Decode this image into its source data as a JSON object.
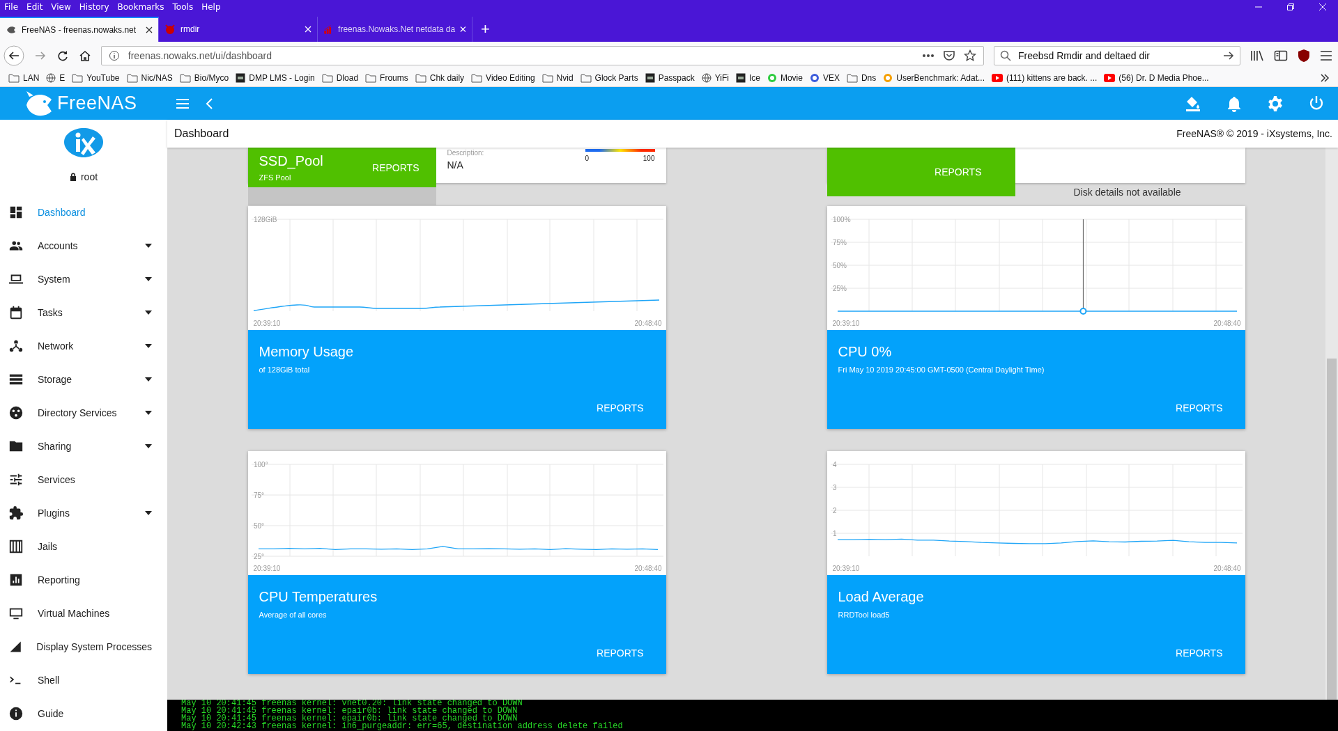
{
  "browser": {
    "menu": [
      "File",
      "Edit",
      "View",
      "History",
      "Bookmarks",
      "Tools",
      "Help"
    ],
    "tabs": [
      {
        "title": "FreeNAS - freenas.nowaks.net",
        "selected": true,
        "kind": "freenas"
      },
      {
        "title": "rmdir",
        "selected": false,
        "kind": "freebsd"
      },
      {
        "title": "freenas.Nowaks.Net netdata da",
        "selected": false,
        "kind": "netdata"
      }
    ],
    "new_tab": "+",
    "address": "freenas.nowaks.net/ui/dashboard",
    "search": {
      "value": "Freebsd Rmdir and deltaed dir"
    },
    "bookmarks": [
      {
        "label": "LAN",
        "kind": "folder"
      },
      {
        "label": "E",
        "kind": "globe"
      },
      {
        "label": "YouTube",
        "kind": "folder"
      },
      {
        "label": "Nic/NAS",
        "kind": "folder"
      },
      {
        "label": "Bio/Myco",
        "kind": "folder"
      },
      {
        "label": "DMP LMS - Login",
        "kind": "app"
      },
      {
        "label": "Dload",
        "kind": "folder"
      },
      {
        "label": "Froums",
        "kind": "folder"
      },
      {
        "label": "Chk daily",
        "kind": "folder"
      },
      {
        "label": "Video Editing",
        "kind": "folder"
      },
      {
        "label": "Nvid",
        "kind": "folder"
      },
      {
        "label": "Glock Parts",
        "kind": "folder"
      },
      {
        "label": "Passpack",
        "kind": "app"
      },
      {
        "label": "YiFi",
        "kind": "globe"
      },
      {
        "label": "Ice",
        "kind": "app"
      },
      {
        "label": "Movie",
        "kind": "dot",
        "color": "#2ecc40"
      },
      {
        "label": "VEX",
        "kind": "dot",
        "color": "#3b5bdb"
      },
      {
        "label": "Dns",
        "kind": "folder"
      },
      {
        "label": "UserBenchmark: Adat...",
        "kind": "dot",
        "color": "#f59f00"
      },
      {
        "label": "(111) kittens are back. ...",
        "kind": "video"
      },
      {
        "label": "(56) Dr. D Media Phoe...",
        "kind": "video"
      }
    ]
  },
  "app_bar": {
    "logo": "FreeNAS"
  },
  "sidebar": {
    "user": "root",
    "items": [
      {
        "label": "Dashboard",
        "selected": true,
        "expandable": false
      },
      {
        "label": "Accounts",
        "selected": false,
        "expandable": true
      },
      {
        "label": "System",
        "selected": false,
        "expandable": true
      },
      {
        "label": "Tasks",
        "selected": false,
        "expandable": true
      },
      {
        "label": "Network",
        "selected": false,
        "expandable": true
      },
      {
        "label": "Storage",
        "selected": false,
        "expandable": true
      },
      {
        "label": "Directory Services",
        "selected": false,
        "expandable": true
      },
      {
        "label": "Sharing",
        "selected": false,
        "expandable": true
      },
      {
        "label": "Services",
        "selected": false,
        "expandable": false
      },
      {
        "label": "Plugins",
        "selected": false,
        "expandable": true
      },
      {
        "label": "Jails",
        "selected": false,
        "expandable": false
      },
      {
        "label": "Reporting",
        "selected": false,
        "expandable": false
      },
      {
        "label": "Virtual Machines",
        "selected": false,
        "expandable": false
      },
      {
        "label": "Display System Processes",
        "selected": false,
        "expandable": false
      },
      {
        "label": "Shell",
        "selected": false,
        "expandable": false
      },
      {
        "label": "Guide",
        "selected": false,
        "expandable": false
      }
    ]
  },
  "page_header": {
    "title": "Dashboard",
    "copyright": "FreeNAS® © 2019 - iXsystems, Inc."
  },
  "pool_card": {
    "name": "SSD_Pool",
    "type": "ZFS Pool",
    "button": "REPORTS",
    "description_label": "Description:",
    "description": "N/A",
    "scale_min": "0",
    "scale_max": "100"
  },
  "disk_card": {
    "button": "REPORTS",
    "note": "Disk details not available"
  },
  "widgets": [
    {
      "title": "Memory Usage",
      "subtitle": "of 128GiB total",
      "button": "REPORTS",
      "max_label": "128GiB",
      "start_time": "20:39:10",
      "end_time": "20:48:40",
      "hover_marker": false
    },
    {
      "title": "CPU 0%",
      "subtitle": "Fri May 10 2019 20:45:00 GMT-0500 (Central Daylight Time)",
      "button": "REPORTS",
      "start_time": "20:39:10",
      "end_time": "20:48:40",
      "hover_marker": true,
      "chart_data": {
        "type": "line",
        "grid": true,
        "ylim": [
          0,
          100
        ],
        "yticks": [
          {
            "value": 25,
            "label": "25%"
          },
          {
            "value": 50,
            "label": "50%"
          },
          {
            "value": 75,
            "label": "75%"
          },
          {
            "value": 100,
            "label": "100%"
          }
        ],
        "series": [
          {
            "color": "#1ea5f7",
            "values": [
              0,
              0,
              0,
              0,
              0,
              0,
              0,
              0,
              0,
              0,
              0,
              0,
              0,
              0,
              0,
              0,
              0,
              0,
              0,
              0
            ]
          }
        ]
      }
    },
    {
      "title": "CPU Temperatures",
      "subtitle": "Average of all cores",
      "button": "REPORTS",
      "start_time": "20:39:10",
      "end_time": "20:48:40",
      "hover_marker": false,
      "chart_data": {
        "type": "line",
        "grid": true,
        "ylim": [
          25,
          100
        ],
        "yticks": [
          {
            "value": 25,
            "label": "25°"
          },
          {
            "value": 50,
            "label": "50°"
          },
          {
            "value": 75,
            "label": "75°"
          },
          {
            "value": 100,
            "label": "100°"
          }
        ],
        "series": [
          {
            "color": "#1ea5f7",
            "values": [
              31,
              31,
              31.5,
              31,
              31.5,
              30.5,
              31,
              31,
              30.8,
              31,
              30.5,
              31,
              33,
              31,
              31,
              31.2,
              31,
              30.8,
              31,
              30.5,
              31.2,
              30.8,
              30.5,
              31,
              30.8,
              31,
              30.5
            ]
          }
        ]
      }
    },
    {
      "title": "Load Average",
      "subtitle": "RRDTool load5",
      "button": "REPORTS",
      "start_time": "20:39:10",
      "end_time": "20:48:40",
      "hover_marker": false,
      "chart_data": {
        "type": "line",
        "grid": true,
        "ylim": [
          0,
          4
        ],
        "yticks": [
          {
            "value": 1,
            "label": "1"
          },
          {
            "value": 2,
            "label": "2"
          },
          {
            "value": 3,
            "label": "3"
          },
          {
            "value": 4,
            "label": "4"
          }
        ],
        "series": [
          {
            "color": "#1ea5f7",
            "values": [
              0.72,
              0.72,
              0.74,
              0.72,
              0.75,
              0.7,
              0.7,
              0.66,
              0.64,
              0.6,
              0.58,
              0.56,
              0.55,
              0.55,
              0.58,
              0.64,
              0.67,
              0.63,
              0.62,
              0.65,
              0.66,
              0.69,
              0.63,
              0.6,
              0.6,
              0.58
            ]
          }
        ]
      }
    }
  ],
  "console": [
    "May 10 20:41:45 freenas kernel: vnet0.20: link state changed to DOWN",
    "May 10 20:41:45 freenas kernel: epair0b: link state changed to DOWN",
    "May 10 20:41:45 freenas kernel: epair0b: link state changed to DOWN",
    "May 10 20:42:43 freenas kernel: in6_purgeaddr: err=65, destination address delete failed"
  ]
}
